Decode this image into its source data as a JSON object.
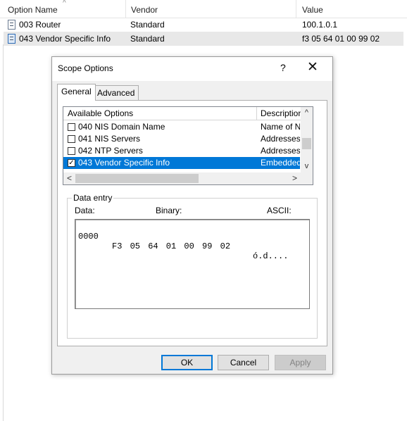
{
  "list_view": {
    "columns": [
      {
        "label": "Option Name"
      },
      {
        "label": "Vendor"
      },
      {
        "label": "Value"
      }
    ],
    "sort_indicator": "^",
    "rows": [
      {
        "icon": "option-icon",
        "name": "003 Router",
        "vendor": "Standard",
        "value": "100.1.0.1",
        "selected": false
      },
      {
        "icon": "vendor-option-icon",
        "name": "043 Vendor Specific Info",
        "vendor": "Standard",
        "value": "f3 05 64 01 00 99 02",
        "selected": true
      }
    ]
  },
  "dialog": {
    "title": "Scope Options",
    "help_label": "?",
    "close_label": "✕",
    "tabs": [
      {
        "label": "General",
        "active": true
      },
      {
        "label": "Advanced",
        "active": false
      }
    ],
    "options_list": {
      "columns": [
        "Available Options",
        "Description"
      ],
      "rows": [
        {
          "name": "040 NIS Domain Name",
          "description": "Name of Ne",
          "checked": false,
          "selected": false
        },
        {
          "name": "041 NIS Servers",
          "description": "Addresses c",
          "checked": false,
          "selected": false
        },
        {
          "name": "042 NTP Servers",
          "description": "Addresses c",
          "checked": false,
          "selected": false
        },
        {
          "name": "043 Vendor Specific Info",
          "description": "Embedded v",
          "checked": true,
          "selected": true
        }
      ],
      "scroll_up": "^",
      "scroll_down": "v",
      "scroll_left": "<",
      "scroll_right": ">"
    },
    "data_entry": {
      "legend": "Data entry",
      "data_label": "Data:",
      "binary_label": "Binary:",
      "ascii_label": "ASCII:",
      "address": "0000",
      "bytes": "F3 05 64 01 00 99 02",
      "ascii": "ó.d...."
    },
    "buttons": {
      "ok": "OK",
      "cancel": "Cancel",
      "apply": "Apply"
    }
  }
}
